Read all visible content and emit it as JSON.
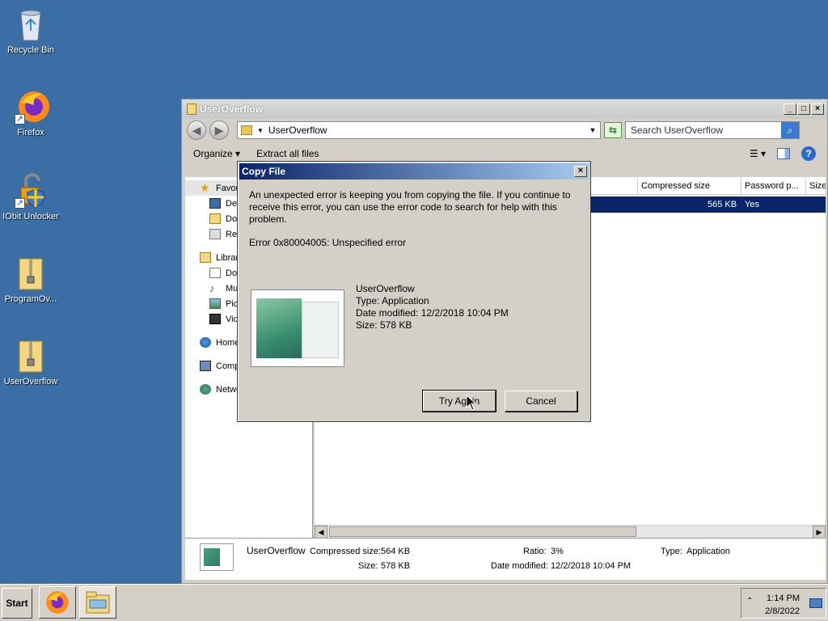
{
  "desktop": {
    "icons": [
      {
        "label": "Recycle Bin",
        "icon": "recycle-bin-icon"
      },
      {
        "label": "Firefox",
        "icon": "firefox-icon"
      },
      {
        "label": "IObit Unlocker",
        "icon": "iobit-unlocker-icon"
      },
      {
        "label": "ProgramOv...",
        "icon": "zip-folder-icon"
      },
      {
        "label": "UserOverflow",
        "icon": "zip-folder-icon"
      }
    ]
  },
  "explorer": {
    "title": "UserOverflow",
    "address": "UserOverflow",
    "search_placeholder": "Search UserOverflow",
    "toolbar": {
      "organize": "Organize",
      "extract": "Extract all files"
    },
    "nav": {
      "favorites": "Favorites",
      "desktop": "Desktop",
      "downloads": "Downloads",
      "recent": "Recent Places",
      "libraries": "Libraries",
      "documents": "Documents",
      "music": "Music",
      "pictures": "Pictures",
      "videos": "Videos",
      "homegroup": "Homegroup",
      "computer": "Computer",
      "network": "Network"
    },
    "columns": {
      "compressed": "Compressed size",
      "password": "Password p...",
      "size": "Size"
    },
    "row": {
      "compressed": "565 KB",
      "password": "Yes"
    },
    "details": {
      "name": "UserOverflow",
      "compressed_label": "Compressed size:",
      "compressed_value": "564 KB",
      "size_label": "Size:",
      "size_value": "578 KB",
      "ratio_label": "Ratio:",
      "ratio_value": "3%",
      "date_label": "Date modified:",
      "date_value": "12/2/2018 10:04 PM",
      "type_label": "Type:",
      "type_value": "Application"
    }
  },
  "dialog": {
    "title": "Copy File",
    "message": "An unexpected error is keeping you from copying the file. If you continue to receive this error, you can use the error code to search for help with this problem.",
    "error": "Error 0x80004005: Unspecified error",
    "file_name": "UserOverflow",
    "file_type": "Type: Application",
    "file_date": "Date modified: 12/2/2018 10:04 PM",
    "file_size": "Size: 578 KB",
    "try_again": "Try Again",
    "cancel": "Cancel"
  },
  "taskbar": {
    "start": "Start",
    "time": "1:14 PM",
    "date": "2/8/2022"
  }
}
